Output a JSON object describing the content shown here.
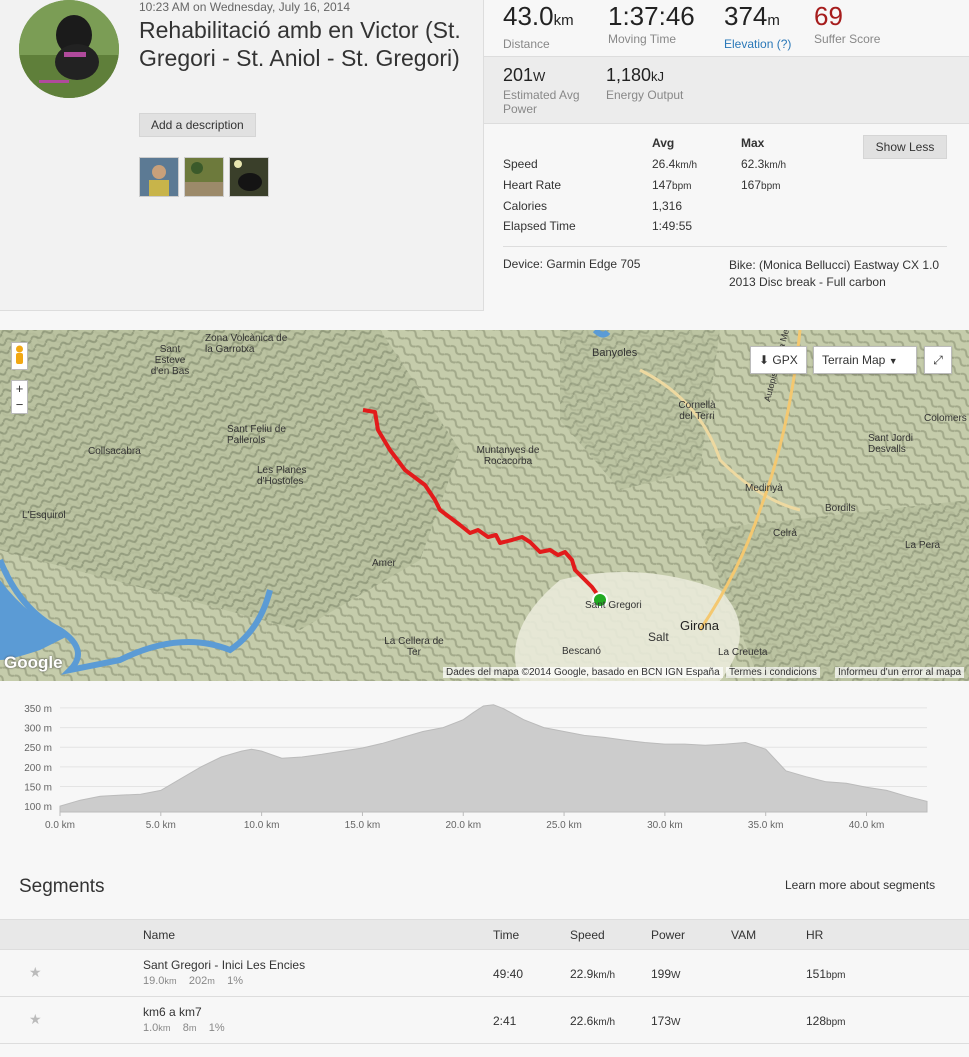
{
  "activity": {
    "datetime": "10:23 AM on Wednesday, July 16, 2014",
    "title": "Rehabilitació amb en Victor (St. Gregori - St. Aniol - St. Gregori)",
    "add_description": "Add a description"
  },
  "stats": {
    "distance": {
      "value": "43.0",
      "unit": "km",
      "label": "Distance"
    },
    "moving_time": {
      "value": "1:37:46",
      "label": "Moving Time"
    },
    "elevation": {
      "value": "374",
      "unit": "m",
      "label": "Elevation (?)"
    },
    "suffer_score": {
      "value": "69",
      "label": "Suffer Score"
    },
    "power": {
      "value": "201",
      "unit": "W",
      "label": "Estimated Avg Power"
    },
    "energy": {
      "value": "1,180",
      "unit": "kJ",
      "label": "Energy Output"
    }
  },
  "detail_table": {
    "avg_header": "Avg",
    "max_header": "Max",
    "rows": [
      {
        "label": "Speed",
        "avg": "26.4",
        "avg_unit": "km/h",
        "max": "62.3",
        "max_unit": "km/h"
      },
      {
        "label": "Heart Rate",
        "avg": "147",
        "avg_unit": "bpm",
        "max": "167",
        "max_unit": "bpm"
      },
      {
        "label": "Calories",
        "avg": "1,316",
        "avg_unit": "",
        "max": "",
        "max_unit": ""
      },
      {
        "label": "Elapsed Time",
        "avg": "1:49:55",
        "avg_unit": "",
        "max": "",
        "max_unit": ""
      }
    ],
    "show_less": "Show Less",
    "device": "Device: Garmin Edge 705",
    "bike": "Bike: (Monica Bellucci) Eastway CX 1.0 2013 Disc break - Full carbon"
  },
  "map": {
    "gpx": "GPX",
    "terrain": "Terrain Map",
    "attribution": "Dades del mapa ©2014 Google, basado en BCN IGN España",
    "terms": "Termes i condicions",
    "report": "Informeu d'un error al mapa",
    "google": "Google",
    "places": [
      {
        "name": "Sant Esteve d'en Bas"
      },
      {
        "name": "Zona Volcànica de la Garrotxa"
      },
      {
        "name": "Banyoles"
      },
      {
        "name": "Collsacabra"
      },
      {
        "name": "Sant Feliu de Pallerols"
      },
      {
        "name": "Les Planes d'Hostoles"
      },
      {
        "name": "Muntanyes de Rocacorba"
      },
      {
        "name": "Cornellà del Terri"
      },
      {
        "name": "Sant Jordi Desvalls"
      },
      {
        "name": "Medinyà"
      },
      {
        "name": "Bordils"
      },
      {
        "name": "Celrà"
      },
      {
        "name": "La Pera"
      },
      {
        "name": "Colomers"
      },
      {
        "name": "L'Esquirol"
      },
      {
        "name": "Amer"
      },
      {
        "name": "La Cellera de Ter"
      },
      {
        "name": "Sant Gregori"
      },
      {
        "name": "Salt"
      },
      {
        "name": "Girona"
      },
      {
        "name": "Bescanó"
      },
      {
        "name": "La Creueta"
      },
      {
        "name": "Autopista de la Mediterrània"
      }
    ]
  },
  "chart_data": {
    "type": "area",
    "x_unit": "km",
    "y_unit": "m",
    "xlim": [
      0,
      43
    ],
    "ylim": [
      85,
      360
    ],
    "yticks": [
      "100 m",
      "150 m",
      "200 m",
      "250 m",
      "300 m",
      "350 m"
    ],
    "xticks": [
      "0.0 km",
      "5.0 km",
      "10.0 km",
      "15.0 km",
      "20.0 km",
      "25.0 km",
      "30.0 km",
      "35.0 km",
      "40.0 km"
    ],
    "x": [
      0,
      1,
      2,
      3,
      4,
      5,
      6,
      7,
      8,
      9,
      9.5,
      10,
      11,
      12,
      13,
      14,
      15,
      16,
      17,
      18,
      19,
      20,
      20.5,
      21,
      21.5,
      22,
      23,
      24,
      25,
      26,
      27,
      28,
      29,
      30,
      31,
      32,
      33,
      34,
      35,
      36,
      37,
      38,
      39,
      40,
      41,
      42,
      43
    ],
    "y": [
      100,
      115,
      125,
      128,
      130,
      140,
      170,
      200,
      225,
      240,
      245,
      240,
      222,
      225,
      232,
      240,
      248,
      260,
      275,
      290,
      300,
      320,
      338,
      355,
      358,
      348,
      320,
      300,
      290,
      280,
      275,
      268,
      262,
      258,
      258,
      255,
      258,
      262,
      245,
      190,
      175,
      162,
      158,
      148,
      140,
      125,
      112
    ]
  },
  "segments": {
    "title": "Segments",
    "learn_more": "Learn more about segments",
    "headers": {
      "name": "Name",
      "time": "Time",
      "speed": "Speed",
      "power": "Power",
      "vam": "VAM",
      "hr": "HR"
    },
    "rows": [
      {
        "name": "Sant Gregori - Inici Les Encies",
        "dist": "19.0",
        "dist_unit": "km",
        "elev": "202",
        "elev_unit": "m",
        "grade": "1%",
        "time": "49:40",
        "speed": "22.9",
        "speed_unit": "km/h",
        "power": "199",
        "power_unit": "W",
        "vam": "",
        "hr": "151",
        "hr_unit": "bpm"
      },
      {
        "name": "km6 a km7",
        "dist": "1.0",
        "dist_unit": "km",
        "elev": "8",
        "elev_unit": "m",
        "grade": "1%",
        "time": "2:41",
        "speed": "22.6",
        "speed_unit": "km/h",
        "power": "173",
        "power_unit": "W",
        "vam": "",
        "hr": "128",
        "hr_unit": "bpm"
      }
    ]
  },
  "colors": {
    "suffer": "#a61c1c",
    "elevation_link": "#2a78b8",
    "route": "#e21b1b",
    "marker": "#22aa22"
  }
}
